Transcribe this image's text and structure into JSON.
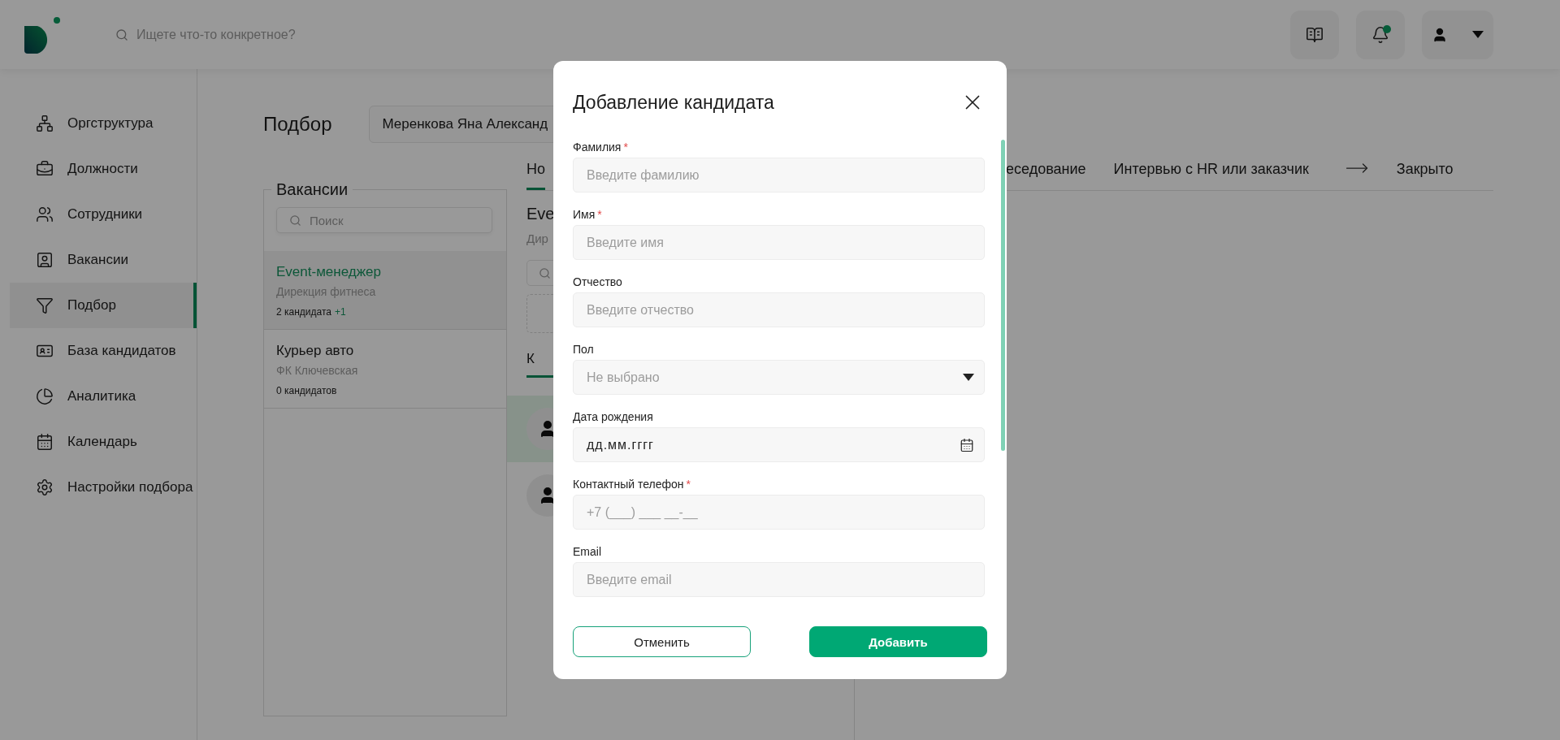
{
  "header": {
    "search_placeholder": "Ищете что-то конкретное?",
    "notifications_unread": true
  },
  "sidebar": {
    "items": [
      {
        "label": "Оргструктура",
        "selected": false
      },
      {
        "label": "Должности",
        "selected": false
      },
      {
        "label": "Сотрудники",
        "selected": false
      },
      {
        "label": "Вакансии",
        "selected": false
      },
      {
        "label": "Подбор",
        "selected": true
      },
      {
        "label": "База кандидатов",
        "selected": false
      },
      {
        "label": "Аналитика",
        "selected": false
      },
      {
        "label": "Календарь",
        "selected": false
      },
      {
        "label": "Настройки подбора",
        "selected": false
      }
    ]
  },
  "page": {
    "title": "Подбор",
    "recruiter": "Меренкова Яна Александ"
  },
  "stage_tabs": [
    {
      "label": "Но",
      "selected": true,
      "arrow_before": false
    },
    {
      "label": "еседование",
      "selected": false,
      "arrow_before": false
    },
    {
      "label": "Интервью с HR или заказчик",
      "selected": false,
      "arrow_before": false
    },
    {
      "label": "Закрыто",
      "selected": false,
      "arrow_before": true
    }
  ],
  "vacancies": {
    "title": "Вакансии",
    "search_placeholder": "Поиск",
    "items": [
      {
        "title": "Event-менеджер",
        "department": "Дирекция фитнеса",
        "count": "2 кандидата",
        "new": "+1",
        "selected": true
      },
      {
        "title": "Курьер авто",
        "department": "ФК Ключевская",
        "count": "0 кандидатов",
        "selected": false
      }
    ]
  },
  "vacancy_detail": {
    "title": "Eve",
    "department": "Дир",
    "tabs": [
      {
        "label": "К",
        "selected": true
      }
    ],
    "candidates": [
      {
        "selected": true
      },
      {
        "selected": false
      }
    ]
  },
  "modal": {
    "title": "Добавление кандидата",
    "fields": [
      {
        "label": "Фамилия",
        "mark": "*",
        "kind": "text",
        "placeholder": "Введите фамилию"
      },
      {
        "label": "Имя",
        "mark": "*",
        "kind": "text",
        "placeholder": "Введите имя"
      },
      {
        "label": "Отчество",
        "kind": "text",
        "placeholder": "Введите отчество"
      },
      {
        "label": "Пол",
        "kind": "select",
        "placeholder": "Не выбрано"
      },
      {
        "label": "Дата рождения",
        "kind": "date",
        "value": "дд.мм.гггг"
      },
      {
        "label": "Контактный телефон",
        "mark": "*",
        "kind": "text",
        "placeholder": "+7 (___) ___ __-__"
      },
      {
        "label": "Email",
        "kind": "text",
        "placeholder": "Введите email"
      }
    ],
    "buttons": [
      {
        "label": "Отменить",
        "kind": "secondary"
      },
      {
        "label": "Добавить",
        "kind": "primary"
      }
    ]
  }
}
